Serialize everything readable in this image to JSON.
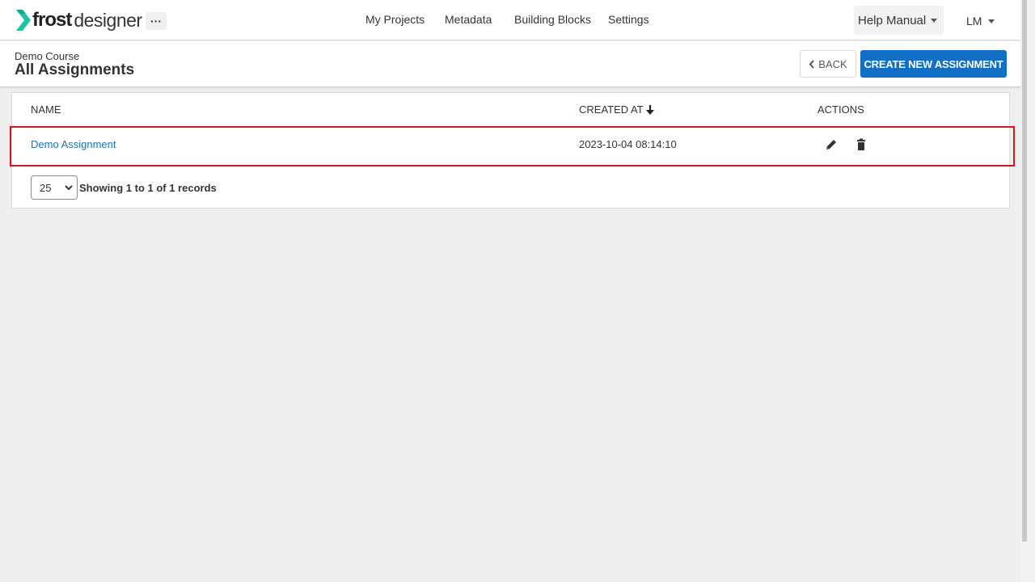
{
  "brand": {
    "frost": "frost",
    "designer": "designer",
    "accent": "#1fc2a3"
  },
  "topbar": {
    "more": "···",
    "nav": [
      "My Projects",
      "Metadata",
      "Building Blocks",
      "Settings"
    ],
    "help": "Help Manual",
    "user": "LM"
  },
  "header": {
    "breadcrumb": "Demo Course",
    "title": "All Assignments",
    "back_label": "BACK",
    "create_label": "CREATE NEW ASSIGNMENT"
  },
  "table": {
    "columns": {
      "name": "NAME",
      "created": "CREATED AT",
      "actions": "ACTIONS"
    },
    "sort": "descending",
    "rows": [
      {
        "name": "Demo Assignment",
        "created_at": "2023-10-04 08:14:10",
        "actions": [
          "edit-icon",
          "trash-icon"
        ]
      }
    ]
  },
  "pagination": {
    "page_size": "25",
    "summary": "Showing 1 to 1 of 1 records"
  },
  "colors": {
    "primary": "#1170c6",
    "link": "#1a73b8",
    "highlight": "#d6161b"
  }
}
